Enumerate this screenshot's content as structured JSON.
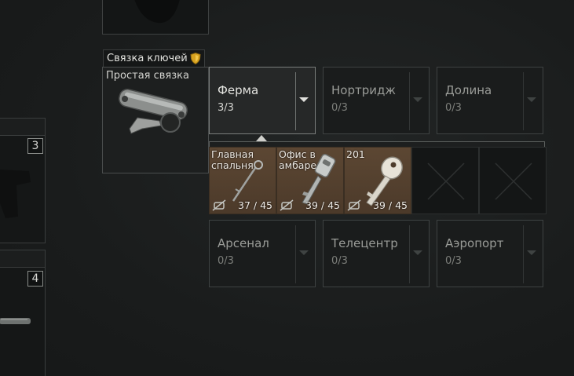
{
  "side_cells": [
    {
      "count": "3"
    },
    {
      "count": "4"
    }
  ],
  "keychain": {
    "title": "Связка ключей",
    "name": "Простая связка"
  },
  "slots_top": [
    {
      "label": "Ферма",
      "count": "3/3",
      "active": true
    },
    {
      "label": "Нортридж",
      "count": "0/3",
      "active": false
    },
    {
      "label": "Долина",
      "count": "0/3",
      "active": false
    }
  ],
  "keys": [
    {
      "name": "Главная спальня",
      "uses": "37 / 45"
    },
    {
      "name": "Офис в амбаре",
      "uses": "39 / 45"
    },
    {
      "name": "201",
      "uses": "39 / 45"
    }
  ],
  "slots_bottom": [
    {
      "label": "Арсенал",
      "count": "0/3",
      "active": false
    },
    {
      "label": "Телецентр",
      "count": "0/3",
      "active": false
    },
    {
      "label": "Аэропорт",
      "count": "0/3",
      "active": false
    }
  ],
  "colors": {
    "active_border": "#7a7e7c",
    "key_cell_bg": "#5c4733",
    "shield": "#d7a21f"
  }
}
